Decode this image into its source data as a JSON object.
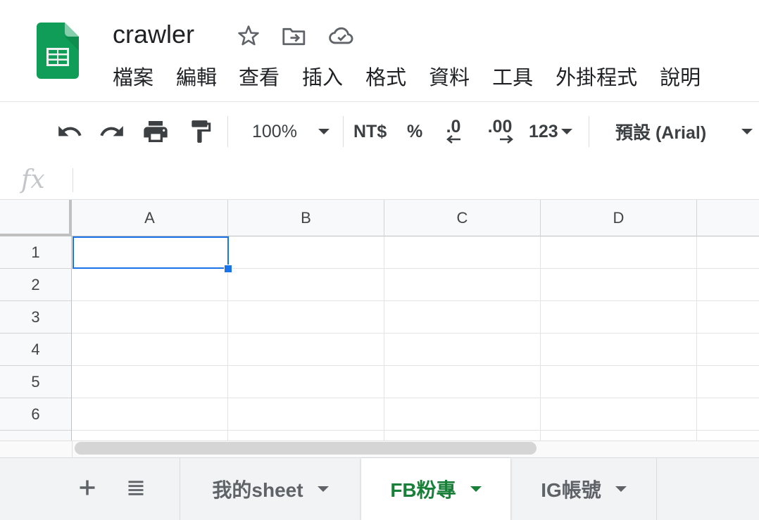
{
  "app": {
    "doc_title": "crawler",
    "brand_color": "#0f9d58"
  },
  "title_icons": [
    "star-icon",
    "move-to-folder-icon",
    "cloud-saved-icon"
  ],
  "menu": [
    "檔案",
    "編輯",
    "查看",
    "插入",
    "格式",
    "資料",
    "工具",
    "外掛程式",
    "說明"
  ],
  "toolbar": {
    "icons": [
      "undo-icon",
      "redo-icon",
      "print-icon",
      "paint-format-icon"
    ],
    "zoom": "100%",
    "currency": "NT$",
    "percent": "%",
    "decrease_decimal": ".0",
    "increase_decimal": ".00",
    "more_formats": "123",
    "font": "預設 (Arial)"
  },
  "formula_bar": {
    "fx_label": "fx",
    "value": ""
  },
  "grid": {
    "columns": [
      "A",
      "B",
      "C",
      "D"
    ],
    "rows": [
      "1",
      "2",
      "3",
      "4",
      "5",
      "6"
    ],
    "selected_cell": "A1",
    "selection_color": "#1a73e8"
  },
  "sheet_tabs": {
    "add_icon": "plus-icon",
    "list_icon": "list-icon",
    "tabs": [
      {
        "label": "我的sheet",
        "active": false
      },
      {
        "label": "FB粉專",
        "active": true
      },
      {
        "label": "IG帳號",
        "active": false
      }
    ],
    "active_color": "#188038"
  }
}
